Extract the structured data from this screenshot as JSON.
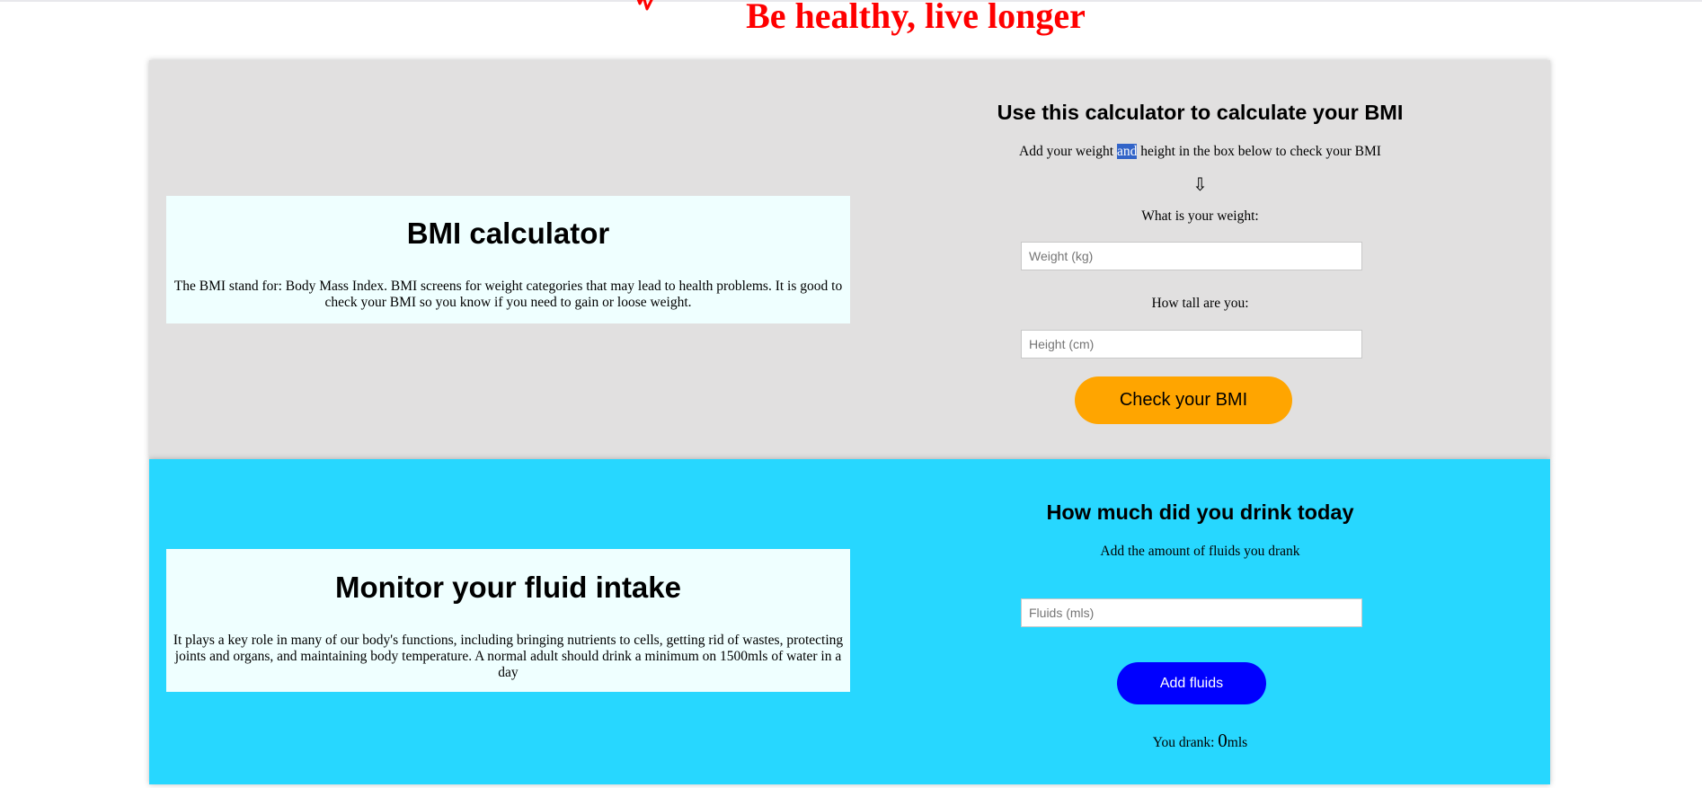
{
  "header": {
    "title": "Be healthy, live longer",
    "logo_icon": "heartbeat-icon",
    "title_color": "#ff0000"
  },
  "bmi_section": {
    "background": "#e1e0e0",
    "info": {
      "title": "BMI calculator",
      "description": "The BMI stand for: Body Mass Index. BMI screens for weight categories that may lead to health problems. It is good to check your BMI so you know if you need to gain or loose weight."
    },
    "form": {
      "heading": "Use this calculator to calculate your BMI",
      "instruction_before": "Add your weight ",
      "instruction_selected": "and",
      "instruction_after": " height in the box below to check your BMI",
      "arrow": "⇩",
      "weight_label": "What is your weight:",
      "weight_placeholder": "Weight (kg)",
      "weight_value": "",
      "height_label": "How tall are you:",
      "height_placeholder": "Height (cm)",
      "height_value": "",
      "button_label": "Check your BMI",
      "button_color": "#ffa500"
    }
  },
  "fluid_section": {
    "background": "#27d7ff",
    "info": {
      "title": "Monitor your fluid intake",
      "description": "It plays a key role in many of our body's functions, including bringing nutrients to cells, getting rid of wastes, protecting joints and organs, and maintaining body temperature. A normal adult should drink a minimum on 1500mls of water in a day"
    },
    "form": {
      "heading": "How much did you drink today",
      "instruction": "Add the amount of fluids you drank",
      "fluid_placeholder": "Fluids (mls)",
      "fluid_value": "",
      "button_label": "Add fluids",
      "button_color": "#0000ff",
      "total_prefix": "You drank: ",
      "total_value": "0",
      "total_unit": "mls"
    }
  }
}
